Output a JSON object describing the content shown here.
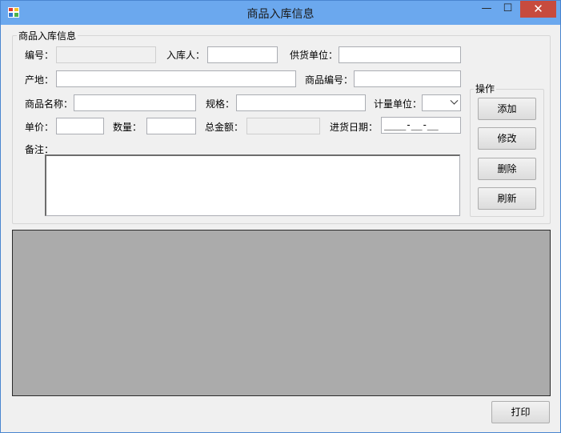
{
  "window": {
    "title": "商品入库信息",
    "controls": {
      "minimize": "—",
      "maximize": "☐",
      "close": "✕"
    }
  },
  "form_group": {
    "title": "商品入库信息",
    "fields": {
      "code": {
        "label": "编号：",
        "value": ""
      },
      "receiver": {
        "label": "入库人：",
        "value": ""
      },
      "supplier": {
        "label": "供货单位：",
        "value": ""
      },
      "origin": {
        "label": "产地：",
        "value": ""
      },
      "product_code": {
        "label": "商品编号：",
        "value": ""
      },
      "product_name": {
        "label": "商品名称：",
        "value": ""
      },
      "spec": {
        "label": "规格：",
        "value": ""
      },
      "unit": {
        "label": "计量单位：",
        "selected": ""
      },
      "price": {
        "label": "单价：",
        "value": ""
      },
      "quantity": {
        "label": "数量：",
        "value": ""
      },
      "total": {
        "label": "总金额：",
        "value": ""
      },
      "purchase_date": {
        "label": "进货日期：",
        "value": "____-__-__"
      },
      "notes": {
        "label": "备注：",
        "value": ""
      }
    }
  },
  "actions_group": {
    "title": "操作",
    "buttons": {
      "add": "添加",
      "edit": "修改",
      "delete": "删除",
      "refresh": "刷新"
    }
  },
  "footer": {
    "print": "打印"
  }
}
